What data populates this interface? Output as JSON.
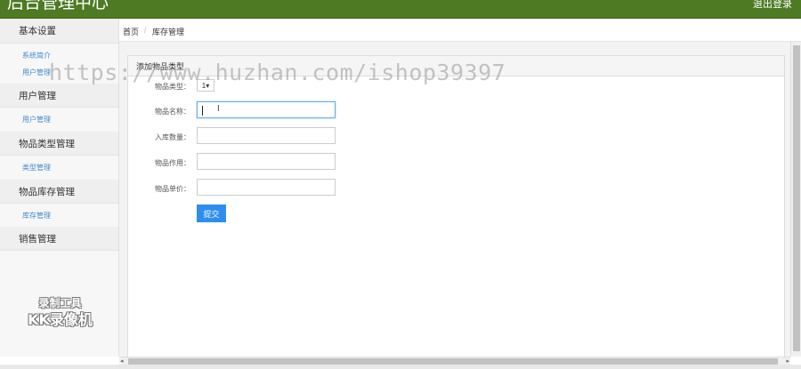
{
  "header": {
    "app_title": "后台管理中心",
    "logout_label": "退出登录"
  },
  "sidebar": {
    "groups": [
      {
        "title": "基本设置",
        "items": [
          "系统简介",
          "用户管理"
        ]
      },
      {
        "title": "用户管理",
        "items": [
          "用户管理"
        ]
      },
      {
        "title": "物品类型管理",
        "items": [
          "类型管理"
        ]
      },
      {
        "title": "物品库存管理",
        "items": [
          "库存管理"
        ]
      },
      {
        "title": "销售管理",
        "items": []
      }
    ]
  },
  "breadcrumb": {
    "home": "首页",
    "separator": "/",
    "current": "库存管理"
  },
  "form": {
    "title": "添加物品类型",
    "type_label": "物品类型：",
    "type_value": "1",
    "name_label": "物品名称：",
    "name_value": "",
    "qty_label": "入库数量：",
    "qty_value": "",
    "use_label": "物品作用：",
    "use_value": "",
    "price_label": "物品单价：",
    "price_value": "",
    "submit_label": "提交"
  },
  "overlay": {
    "watermark": "https://www.huzhan.com/ishop39397",
    "recorder_line1": "录制工具",
    "recorder_line2": "KK录像机"
  },
  "colors": {
    "header": "#4d7a22",
    "link": "#428bca",
    "submit": "#2e8ef0"
  }
}
